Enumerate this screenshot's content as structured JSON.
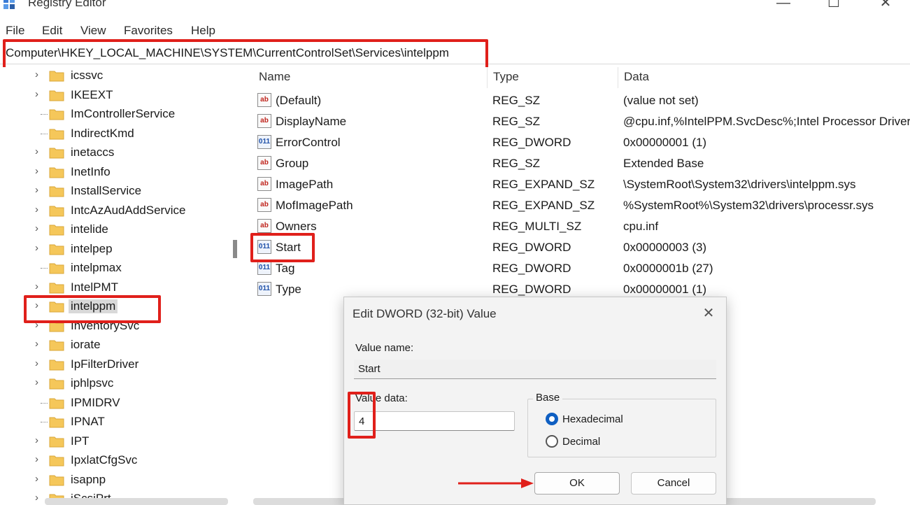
{
  "window": {
    "title": "Registry Editor",
    "minimize": "—",
    "maximize": "☐",
    "close": "✕"
  },
  "menu": [
    "File",
    "Edit",
    "View",
    "Favorites",
    "Help"
  ],
  "address": "Computer\\HKEY_LOCAL_MACHINE\\SYSTEM\\CurrentControlSet\\Services\\intelppm",
  "tree": [
    {
      "label": "icssvc",
      "expandable": true
    },
    {
      "label": "IKEEXT",
      "expandable": true
    },
    {
      "label": "ImControllerService",
      "expandable": false
    },
    {
      "label": "IndirectKmd",
      "expandable": false
    },
    {
      "label": "inetaccs",
      "expandable": true
    },
    {
      "label": "InetInfo",
      "expandable": true
    },
    {
      "label": "InstallService",
      "expandable": true
    },
    {
      "label": "IntcAzAudAddService",
      "expandable": true
    },
    {
      "label": "intelide",
      "expandable": true
    },
    {
      "label": "intelpep",
      "expandable": true
    },
    {
      "label": "intelpmax",
      "expandable": false
    },
    {
      "label": "IntelPMT",
      "expandable": true
    },
    {
      "label": "intelppm",
      "expandable": true,
      "selected": true
    },
    {
      "label": "InventorySvc",
      "expandable": true
    },
    {
      "label": "iorate",
      "expandable": true
    },
    {
      "label": "IpFilterDriver",
      "expandable": true
    },
    {
      "label": "iphlpsvc",
      "expandable": true
    },
    {
      "label": "IPMIDRV",
      "expandable": false
    },
    {
      "label": "IPNAT",
      "expandable": false
    },
    {
      "label": "IPT",
      "expandable": true
    },
    {
      "label": "IpxlatCfgSvc",
      "expandable": true
    },
    {
      "label": "isapnp",
      "expandable": true
    },
    {
      "label": "iScsiPrt",
      "expandable": true
    }
  ],
  "columns": {
    "name": "Name",
    "type": "Type",
    "data": "Data"
  },
  "values": [
    {
      "icon": "string-value-icon",
      "kind": "sz",
      "name": "(Default)",
      "type": "REG_SZ",
      "data": "(value not set)"
    },
    {
      "icon": "string-value-icon",
      "kind": "sz",
      "name": "DisplayName",
      "type": "REG_SZ",
      "data": "@cpu.inf,%IntelPPM.SvcDesc%;Intel Processor Driver"
    },
    {
      "icon": "binary-value-icon",
      "kind": "dword",
      "name": "ErrorControl",
      "type": "REG_DWORD",
      "data": "0x00000001 (1)"
    },
    {
      "icon": "string-value-icon",
      "kind": "sz",
      "name": "Group",
      "type": "REG_SZ",
      "data": "Extended Base"
    },
    {
      "icon": "string-value-icon",
      "kind": "sz",
      "name": "ImagePath",
      "type": "REG_EXPAND_SZ",
      "data": "\\SystemRoot\\System32\\drivers\\intelppm.sys"
    },
    {
      "icon": "string-value-icon",
      "kind": "sz",
      "name": "MofImagePath",
      "type": "REG_EXPAND_SZ",
      "data": "%SystemRoot%\\System32\\drivers\\processr.sys"
    },
    {
      "icon": "string-value-icon",
      "kind": "sz",
      "name": "Owners",
      "type": "REG_MULTI_SZ",
      "data": "cpu.inf"
    },
    {
      "icon": "binary-value-icon",
      "kind": "dword",
      "name": "Start",
      "type": "REG_DWORD",
      "data": "0x00000003 (3)",
      "selected": true
    },
    {
      "icon": "binary-value-icon",
      "kind": "dword",
      "name": "Tag",
      "type": "REG_DWORD",
      "data": "0x0000001b (27)"
    },
    {
      "icon": "binary-value-icon",
      "kind": "dword",
      "name": "Type",
      "type": "REG_DWORD",
      "data": "0x00000001 (1)"
    }
  ],
  "dialog": {
    "title": "Edit DWORD (32-bit) Value",
    "close": "✕",
    "value_name_label": "Value name:",
    "value_name": "Start",
    "value_data_label": "Value data:",
    "value_data": "4",
    "base_label": "Base",
    "hex_label": "Hexadecimal",
    "dec_label": "Decimal",
    "base_selected": "Hexadecimal",
    "ok": "OK",
    "cancel": "Cancel"
  },
  "colors": {
    "highlight": "#e0201b",
    "accent": "#0f5fc2",
    "folder": "#f5c75a"
  }
}
